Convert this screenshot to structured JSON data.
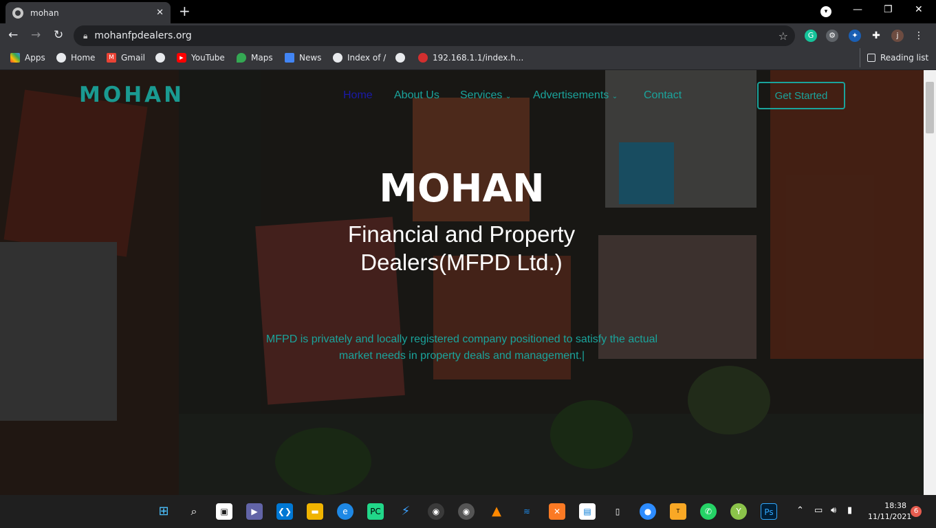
{
  "browser": {
    "tab_title": "mohan",
    "new_tab": "+",
    "url": "mohanfpdealers.org",
    "profile_initial": "j",
    "bookmarks": [
      {
        "label": "Apps",
        "icon": "apps-grid-icon"
      },
      {
        "label": "Home",
        "icon": "globe-icon"
      },
      {
        "label": "Gmail",
        "icon": "gmail-icon"
      },
      {
        "label": "",
        "icon": "globe-icon"
      },
      {
        "label": "YouTube",
        "icon": "youtube-icon"
      },
      {
        "label": "Maps",
        "icon": "maps-icon"
      },
      {
        "label": "News",
        "icon": "news-icon"
      },
      {
        "label": "Index of /",
        "icon": "globe-icon"
      },
      {
        "label": "",
        "icon": "globe-icon"
      },
      {
        "label": "192.168.1.1/index.h...",
        "icon": "router-icon"
      }
    ],
    "reading_list": "Reading list"
  },
  "site": {
    "brand": "MOHAN",
    "nav": [
      "Home",
      "About Us",
      "Services",
      "Advertisements",
      "Contact"
    ],
    "cta": "Get Started",
    "hero_title": "MOHAN",
    "hero_subtitle": "Financial and Property Dealers(MFPD Ltd.)",
    "hero_lead": "MFPD is privately and locally registered company positioned to satisfy the actual market needs in property deals and management.|"
  },
  "taskbar": {
    "time": "18:38",
    "date": "11/11/2021",
    "notifications": "6"
  },
  "colors": {
    "accent": "#1aa49c",
    "nav_active": "#1a1aa8"
  }
}
